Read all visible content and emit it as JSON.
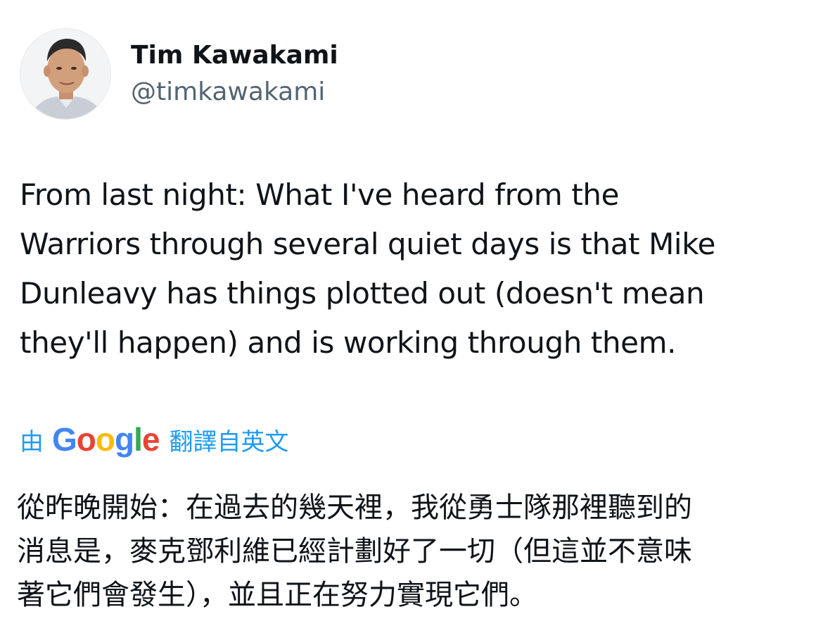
{
  "author": {
    "display_name": "Tim Kawakami",
    "handle": "@timkawakami"
  },
  "tweet": {
    "lines": [
      "From last night: What I've heard from the",
      "Warriors through several quiet days is that Mike",
      "Dunleavy has things plotted out (doesn't mean",
      "they'll happen) and is working through them."
    ]
  },
  "translation": {
    "by_label": "由",
    "service_name": "Google",
    "service_letters": [
      "G",
      "o",
      "o",
      "g",
      "l",
      "e"
    ],
    "service_colors": [
      "#4285f4",
      "#ea4335",
      "#fbbc05",
      "#4285f4",
      "#34a853",
      "#ea4335"
    ],
    "translated_from_label": "翻譯自英文",
    "lines": [
      "從昨晚開始：在過去的幾天裡，我從勇士隊那裡聽到的",
      "消息是，麥克鄧利維已經計劃好了一切（但這並不意味",
      "著它們會發生），並且正在努力實現它們。"
    ]
  },
  "colors": {
    "link": "#1d9bf0",
    "handle": "#536471",
    "text": "#0f1419"
  },
  "icons": {
    "avatar": "profile-photo"
  }
}
